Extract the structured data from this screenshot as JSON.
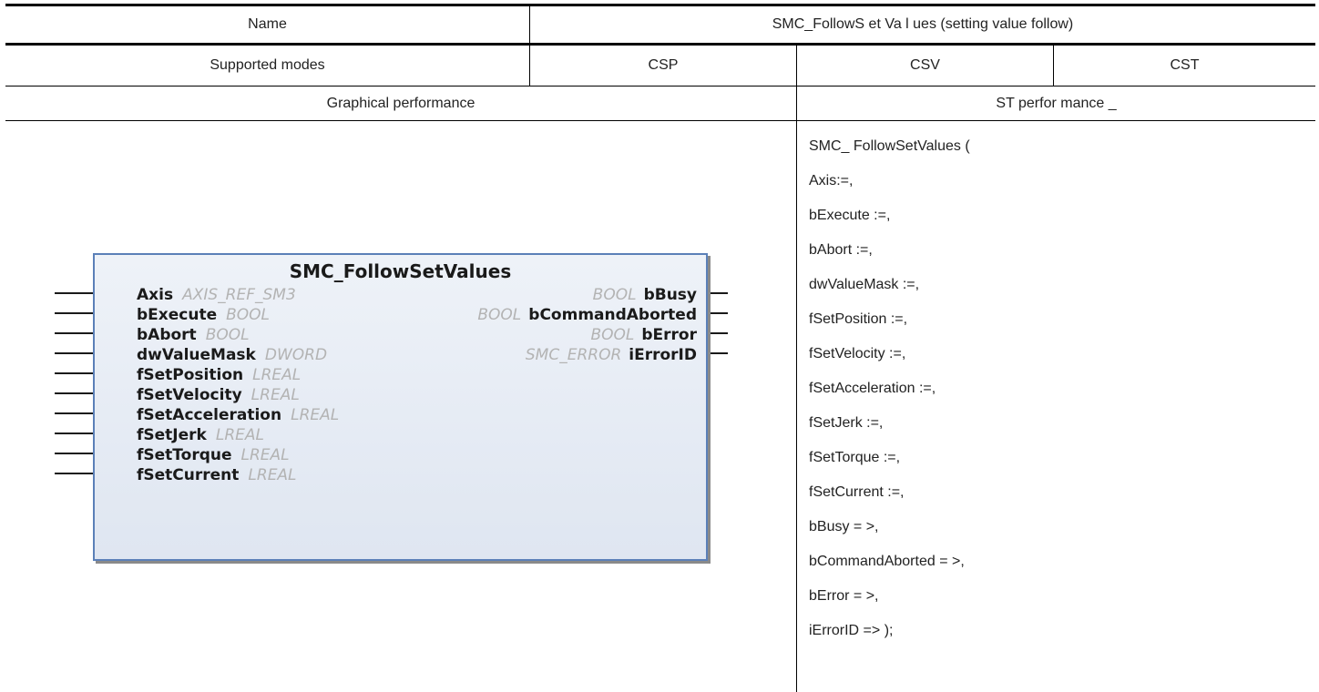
{
  "header": {
    "name_label": "Name",
    "name_value": "SMC_FollowS et Va l ues (setting value follow)"
  },
  "modes": {
    "label": "Supported modes",
    "csp": "CSP",
    "csv": "CSV",
    "cst": "CST"
  },
  "sections": {
    "graphical": "Graphical performance",
    "st": "ST perfor mance _"
  },
  "function_block": {
    "title": "SMC_FollowSetValues",
    "inputs": [
      {
        "name": "Axis",
        "type": "AXIS_REF_SM3"
      },
      {
        "name": "bExecute",
        "type": "BOOL"
      },
      {
        "name": "bAbort",
        "type": "BOOL"
      },
      {
        "name": "dwValueMask",
        "type": "DWORD"
      },
      {
        "name": "fSetPosition",
        "type": "LREAL"
      },
      {
        "name": "fSetVelocity",
        "type": "LREAL"
      },
      {
        "name": "fSetAcceleration",
        "type": "LREAL"
      },
      {
        "name": "fSetJerk",
        "type": "LREAL"
      },
      {
        "name": "fSetTorque",
        "type": "LREAL"
      },
      {
        "name": "fSetCurrent",
        "type": "LREAL"
      }
    ],
    "outputs": [
      {
        "name": "bBusy",
        "type": "BOOL"
      },
      {
        "name": "bCommandAborted",
        "type": "BOOL"
      },
      {
        "name": "bError",
        "type": "BOOL"
      },
      {
        "name": "iErrorID",
        "type": "SMC_ERROR"
      }
    ]
  },
  "st_code": [
    "SMC_ FollowSetValues (",
    "Axis:=,",
    "bExecute :=,",
    "bAbort :=,",
    "dwValueMask :=,",
    "fSetPosition :=,",
    "fSetVelocity :=,",
    "fSetAcceleration :=,",
    "fSetJerk :=,",
    "fSetTorque :=,",
    "fSetCurrent :=,",
    "bBusy = >,",
    "bCommandAborted = >,",
    "bError = >,",
    "iErrorID => );"
  ],
  "colors": {
    "block_border": "#5b80b8",
    "block_fill": "#e7ecf5",
    "type_text": "#b3b3b3"
  }
}
